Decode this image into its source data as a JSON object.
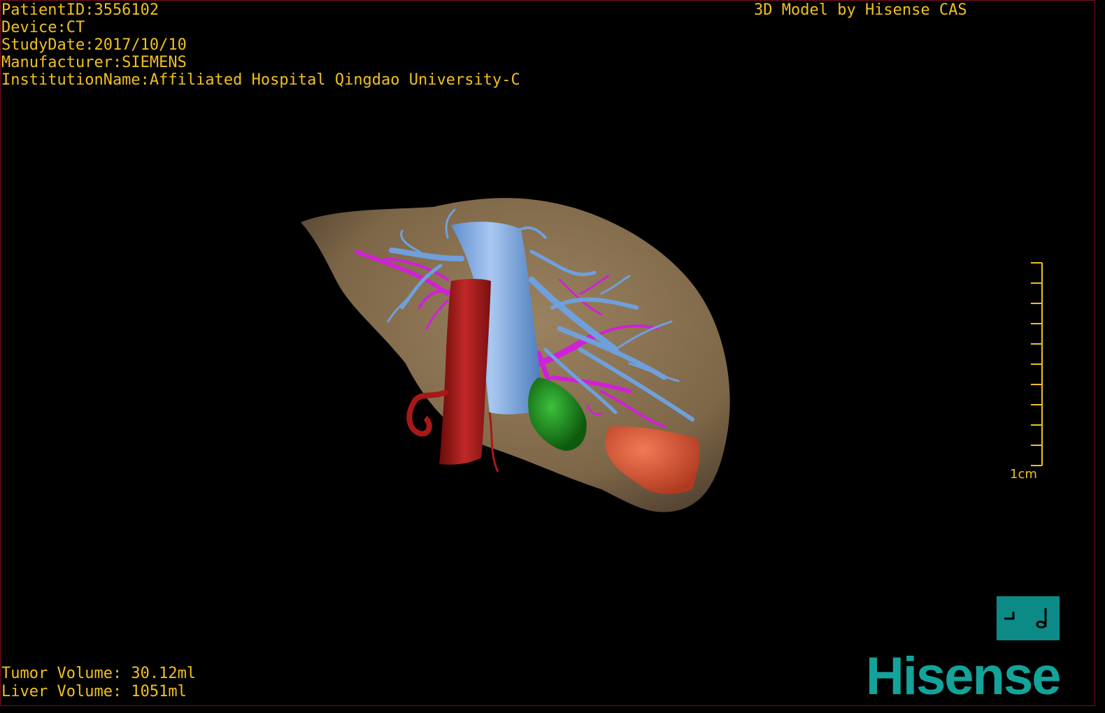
{
  "header": {
    "patient_id": "PatientID:3556102",
    "device": "Device:CT",
    "study_date": "StudyDate:2017/10/10",
    "manufacturer": "Manufacturer:SIEMENS",
    "institution": "InstitutionName:Affiliated Hospital Qingdao University-C",
    "credit": "3D Model by Hisense CAS"
  },
  "volumes": {
    "tumor": "Tumor Volume: 30.12ml",
    "liver": "Liver Volume: 1051ml"
  },
  "scale_bar": {
    "label": "1cm",
    "ticks": 10
  },
  "orientation_icon": "posterior-left-orientation-icon",
  "brand": {
    "logo": "Hisense",
    "color": "#14a39a"
  },
  "colors": {
    "overlay_text": "#f0c020",
    "liver": "#8a7250",
    "hepatic_vein": "#6fa0dc",
    "portal_vein": "#d020d8",
    "artery_aorta": "#a81818",
    "gallbladder": "#1f9a1f",
    "tumor": "#e06040"
  },
  "model_parts": [
    "liver",
    "inferior-vena-cava",
    "hepatic-veins",
    "portal-veins",
    "aorta",
    "gallbladder",
    "tumor"
  ]
}
